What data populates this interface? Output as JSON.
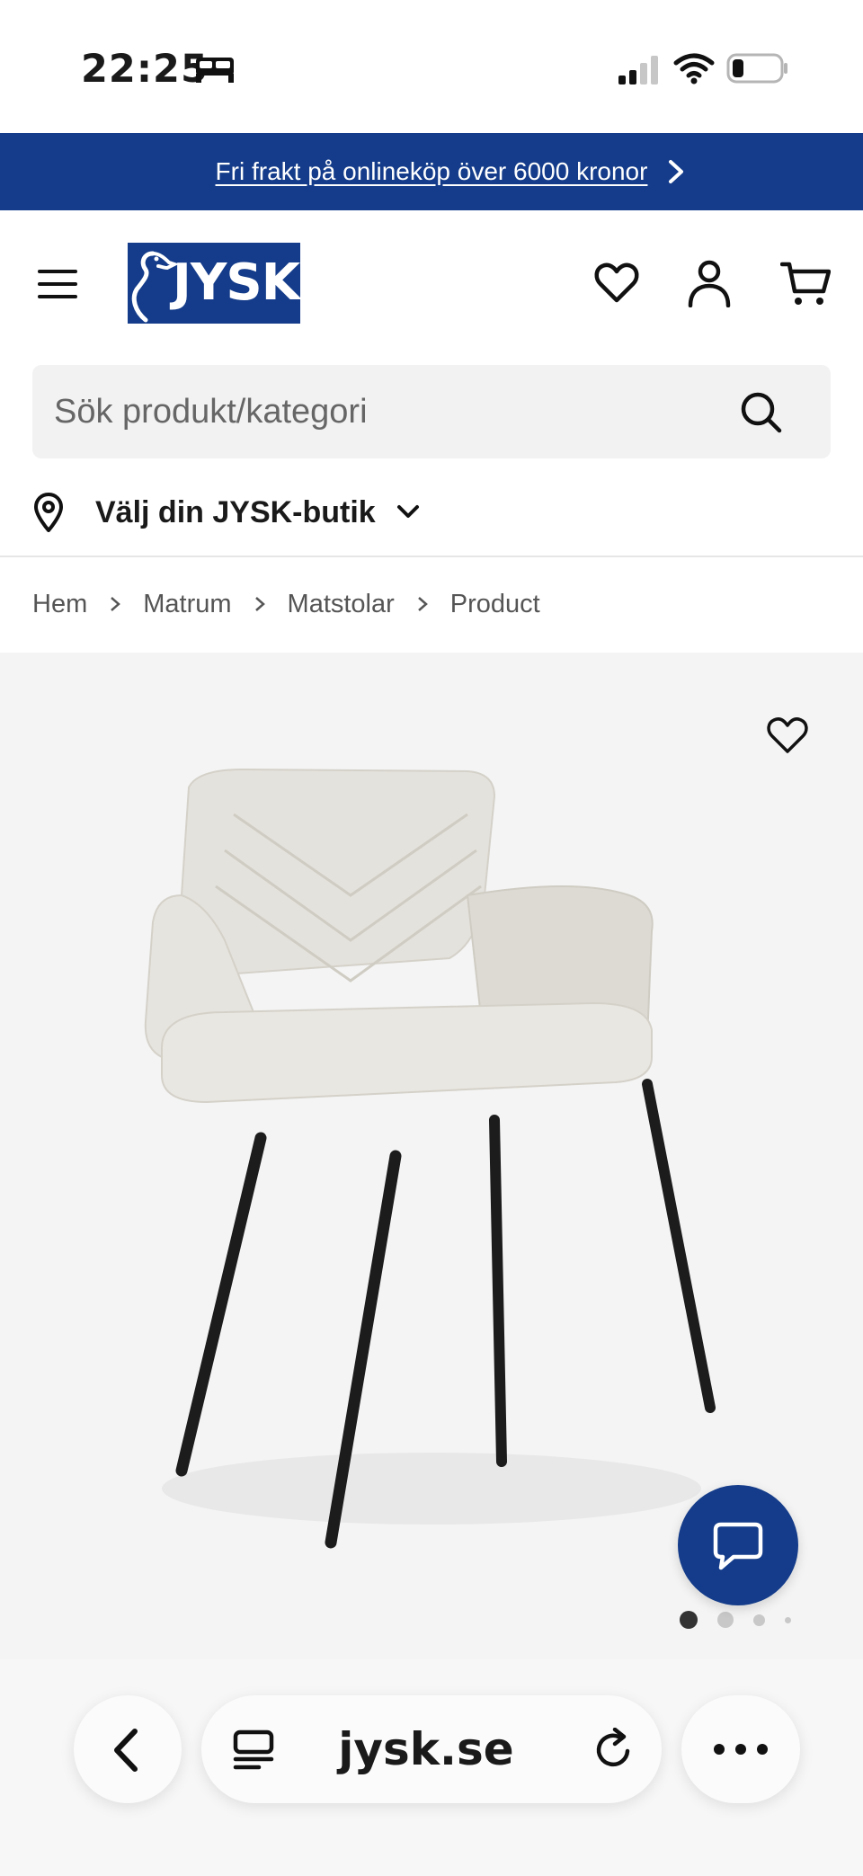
{
  "status_bar": {
    "time": "22:25",
    "icons": [
      "bed-icon",
      "cellular-signal-icon",
      "wifi-icon",
      "battery-icon"
    ]
  },
  "promo": {
    "text": "Fri frakt på onlineköp över 6000 kronor"
  },
  "header": {
    "logo_text": "JYSK",
    "icons": [
      "menu-icon",
      "heart-icon",
      "user-icon",
      "cart-icon"
    ]
  },
  "search": {
    "placeholder": "Sök produkt/kategori",
    "value": ""
  },
  "store": {
    "label": "Välj din JYSK-butik"
  },
  "breadcrumb": {
    "items": [
      "Hem",
      "Matrum",
      "Matstolar",
      "Product"
    ]
  },
  "gallery": {
    "image_subject": "upholstered dining chair with armrests",
    "current_index": 1,
    "total_dots": 4
  },
  "browser": {
    "url": "jysk.se"
  },
  "colors": {
    "brand_blue": "#143c8a",
    "background": "#ffffff",
    "product_bg": "#f4f4f4",
    "search_bg": "#f2f2f2"
  }
}
